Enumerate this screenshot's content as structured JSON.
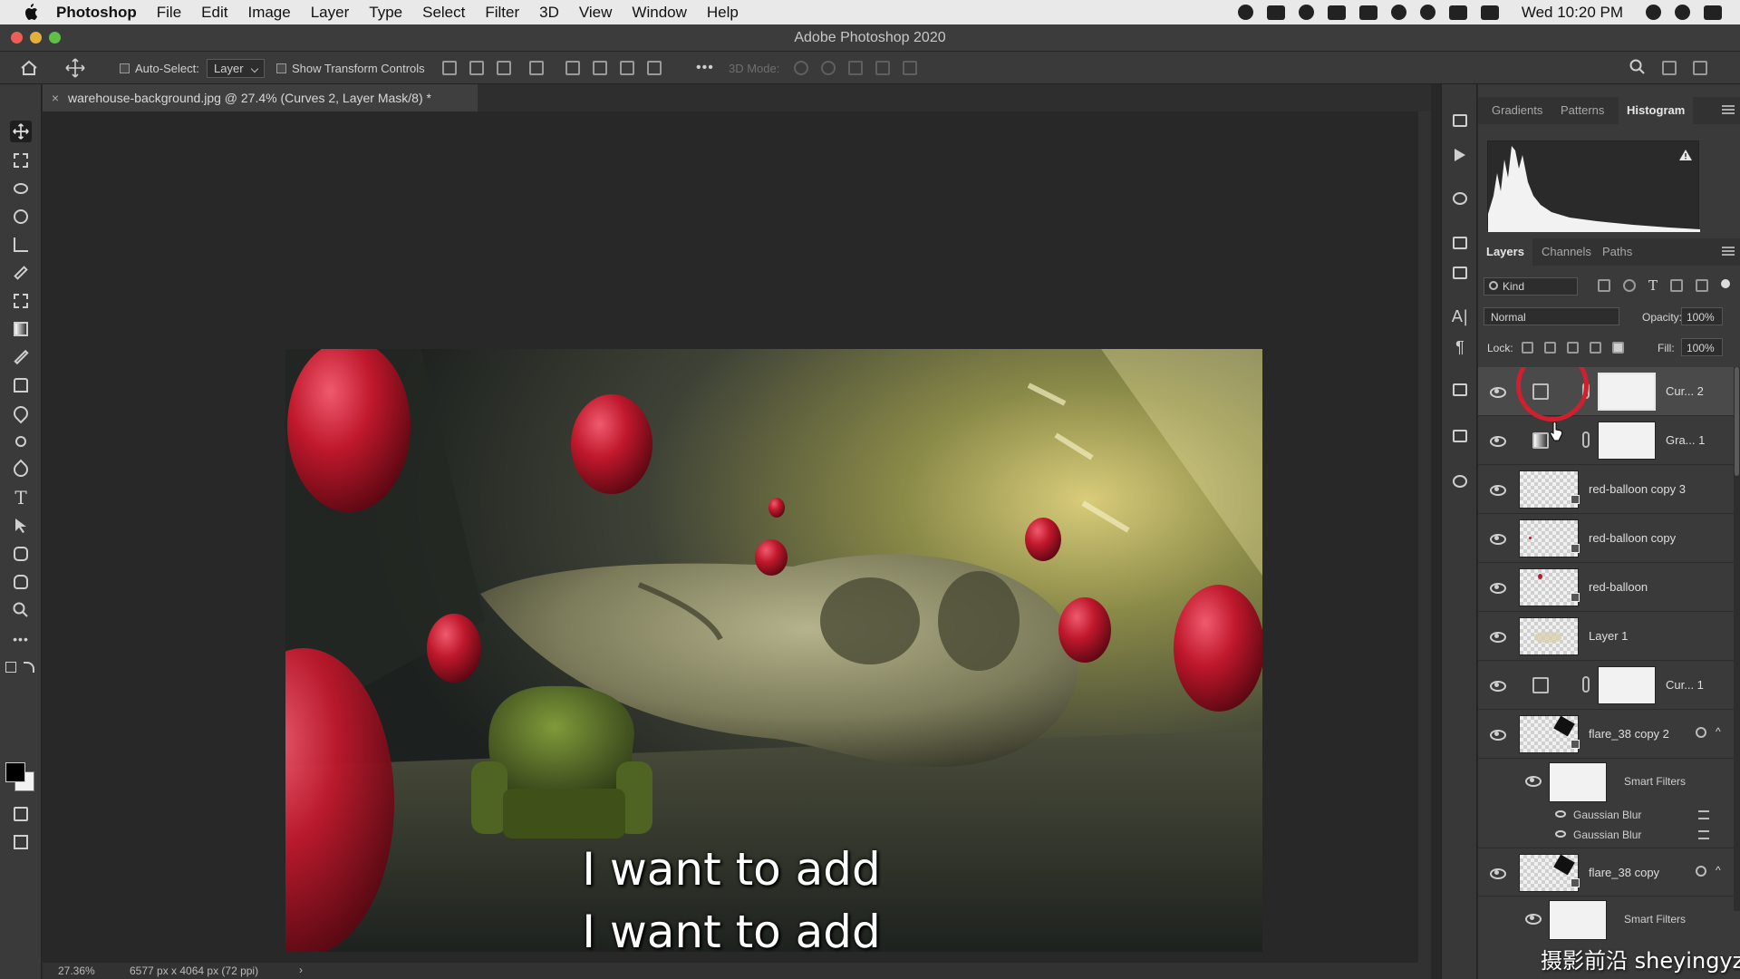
{
  "menubar": {
    "app_name": "Photoshop",
    "items": [
      "File",
      "Edit",
      "Image",
      "Layer",
      "Type",
      "Select",
      "Filter",
      "3D",
      "View",
      "Window",
      "Help"
    ],
    "clock": "Wed 10:20 PM"
  },
  "window": {
    "title": "Adobe Photoshop 2020"
  },
  "options_bar": {
    "auto_select_label": "Auto-Select:",
    "auto_select_value": "Layer",
    "transform_label": "Show Transform Controls",
    "mode_3d_label": "3D Mode:",
    "more": "•••"
  },
  "document": {
    "tab_title": "warehouse-background.jpg @ 27.4% (Curves 2, Layer Mask/8) *",
    "zoom": "27.36%",
    "doc_info": "6577 px x 4064 px (72 ppi)"
  },
  "subtitles": [
    "I want to add",
    "I want to add"
  ],
  "histogram_panel": {
    "tabs": [
      "Gradients",
      "Patterns",
      "Histogram"
    ],
    "active_tab": "Histogram"
  },
  "layers_panel": {
    "tabs": [
      "Layers",
      "Channels",
      "Paths"
    ],
    "active_tab": "Layers",
    "filter_kind": "Kind",
    "blend_mode": "Normal",
    "opacity_label": "Opacity:",
    "opacity": "100%",
    "lock_label": "Lock:",
    "fill_label": "Fill:",
    "fill": "100%",
    "layers": [
      {
        "name": "Cur... 2",
        "type": "adjustment"
      },
      {
        "name": "Gra... 1",
        "type": "adjustment"
      },
      {
        "name": "red-balloon copy 3",
        "type": "smart"
      },
      {
        "name": "red-balloon copy",
        "type": "smart"
      },
      {
        "name": "red-balloon",
        "type": "smart"
      },
      {
        "name": "Layer 1",
        "type": "pixel"
      },
      {
        "name": "Cur... 1",
        "type": "adjustment"
      },
      {
        "name": "flare_38 copy 2",
        "type": "smart"
      },
      {
        "name": "flare_38 copy",
        "type": "smart"
      }
    ],
    "smart_filters_label": "Smart Filters",
    "filters": [
      "Gaussian Blur",
      "Gaussian Blur"
    ]
  },
  "watermark": "摄影前沿 sheyingyz.com",
  "colors": {
    "accent_red": "#c0182c",
    "panel": "#3a3a3a",
    "canvas_bg": "#282828"
  }
}
